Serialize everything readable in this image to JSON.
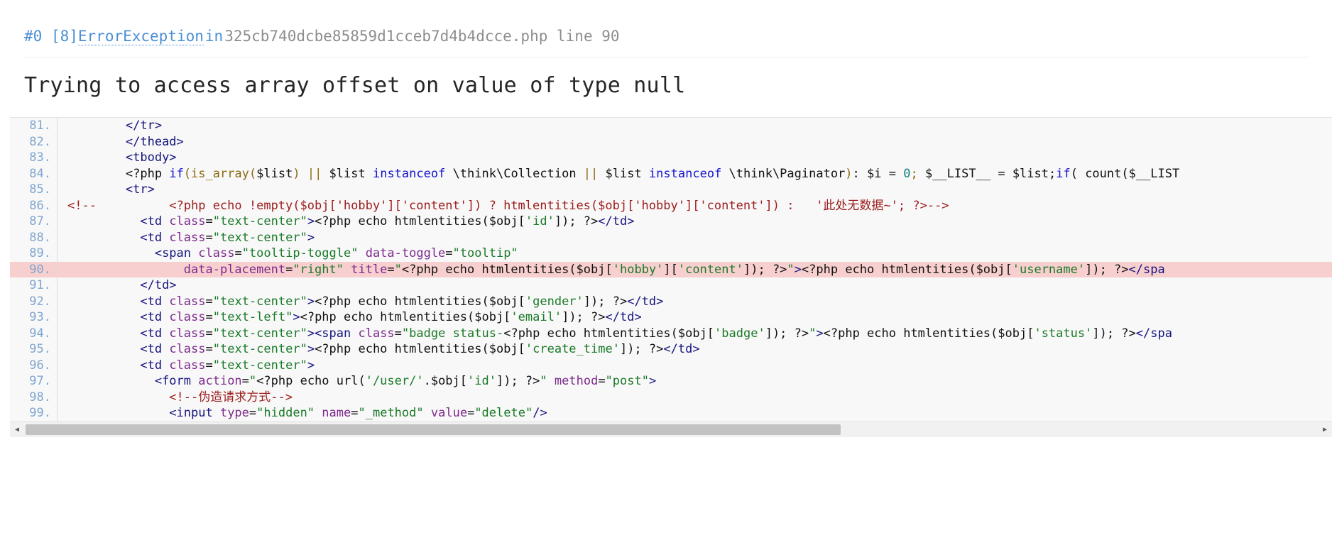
{
  "exception": {
    "frame_index": "#0",
    "type_bracket": "[8]",
    "class_name": "ErrorException",
    "in_word": "in",
    "file": "325cb740dcbe85859d1cceb7d4b4dcce.php",
    "line_word": "line",
    "line_number": "90",
    "message": "Trying to access array offset on value of type null"
  },
  "colors": {
    "link": "#4a8fd4",
    "file": "#8d8d8d",
    "highlight_row": "#f8cfcf",
    "code_bg": "#f8f8f8",
    "gutter_text": "#7ea6cf",
    "comment": "#9c1c1c",
    "tag": "#15147f",
    "attr": "#7d2a8c",
    "string": "#1a7a28",
    "keyword": "#1414cf"
  },
  "code": {
    "highlighted_line": 90,
    "lines": [
      {
        "n": "81.",
        "tokens": [
          {
            "t": "        ",
            "c": "t-plain"
          },
          {
            "t": "</tr>",
            "c": "t-tag"
          }
        ]
      },
      {
        "n": "82.",
        "tokens": [
          {
            "t": "        ",
            "c": "t-plain"
          },
          {
            "t": "</thead>",
            "c": "t-tag"
          }
        ]
      },
      {
        "n": "83.",
        "tokens": [
          {
            "t": "        ",
            "c": "t-plain"
          },
          {
            "t": "<tbody>",
            "c": "t-tag"
          }
        ]
      },
      {
        "n": "84.",
        "tokens": [
          {
            "t": "        ",
            "c": "t-plain"
          },
          {
            "t": "<?php ",
            "c": "t-php"
          },
          {
            "t": "if",
            "c": "t-kw"
          },
          {
            "t": "(is_array(",
            "c": "t-punc"
          },
          {
            "t": "$list",
            "c": "t-var"
          },
          {
            "t": ") ",
            "c": "t-punc"
          },
          {
            "t": "||",
            "c": "t-punc"
          },
          {
            "t": " $list ",
            "c": "t-var"
          },
          {
            "t": "instanceof",
            "c": "t-kw"
          },
          {
            "t": " \\think\\Collection ",
            "c": "t-plain"
          },
          {
            "t": "||",
            "c": "t-punc"
          },
          {
            "t": " $list ",
            "c": "t-var"
          },
          {
            "t": "instanceof",
            "c": "t-kw"
          },
          {
            "t": " \\think\\Paginator",
            "c": "t-plain"
          },
          {
            "t": ")",
            "c": "t-punc"
          },
          {
            "t": ": $i ",
            "c": "t-plain"
          },
          {
            "t": "=",
            "c": "t-plain"
          },
          {
            "t": " ",
            "c": "t-plain"
          },
          {
            "t": "0",
            "c": "t-num"
          },
          {
            "t": ";",
            "c": "t-punc"
          },
          {
            "t": " $__LIST__ ",
            "c": "t-plain"
          },
          {
            "t": "=",
            "c": "t-plain"
          },
          {
            "t": " $list;",
            "c": "t-plain"
          },
          {
            "t": "if",
            "c": "t-kw"
          },
          {
            "t": "( count($__LIST",
            "c": "t-plain"
          }
        ]
      },
      {
        "n": "85.",
        "tokens": [
          {
            "t": "        ",
            "c": "t-plain"
          },
          {
            "t": "<tr>",
            "c": "t-tag"
          }
        ]
      },
      {
        "n": "86.",
        "tokens": [
          {
            "t": "<!--          <?php echo !empty($obj['hobby']['content']) ? htmlentities($obj['hobby']['content']) :   '此处无数据~'; ?>-->",
            "c": "t-cmt"
          }
        ],
        "comment_full": true
      },
      {
        "n": "87.",
        "tokens": [
          {
            "t": "          ",
            "c": "t-plain"
          },
          {
            "t": "<td ",
            "c": "t-tag"
          },
          {
            "t": "class",
            "c": "t-attr"
          },
          {
            "t": "=",
            "c": "t-plain"
          },
          {
            "t": "\"text-center\"",
            "c": "t-str"
          },
          {
            "t": ">",
            "c": "t-tag"
          },
          {
            "t": "<?php echo htmlentities(",
            "c": "t-plain"
          },
          {
            "t": "$obj[",
            "c": "t-plain"
          },
          {
            "t": "'id'",
            "c": "t-str"
          },
          {
            "t": "]); ?>",
            "c": "t-plain"
          },
          {
            "t": "</td>",
            "c": "t-tag"
          }
        ]
      },
      {
        "n": "88.",
        "tokens": [
          {
            "t": "          ",
            "c": "t-plain"
          },
          {
            "t": "<td ",
            "c": "t-tag"
          },
          {
            "t": "class",
            "c": "t-attr"
          },
          {
            "t": "=",
            "c": "t-plain"
          },
          {
            "t": "\"text-center\"",
            "c": "t-str"
          },
          {
            "t": ">",
            "c": "t-tag"
          }
        ]
      },
      {
        "n": "89.",
        "tokens": [
          {
            "t": "            ",
            "c": "t-plain"
          },
          {
            "t": "<span ",
            "c": "t-tag"
          },
          {
            "t": "class",
            "c": "t-attr"
          },
          {
            "t": "=",
            "c": "t-plain"
          },
          {
            "t": "\"tooltip-toggle\"",
            "c": "t-str"
          },
          {
            "t": " ",
            "c": "t-plain"
          },
          {
            "t": "data-toggle",
            "c": "t-attr"
          },
          {
            "t": "=",
            "c": "t-plain"
          },
          {
            "t": "\"tooltip\"",
            "c": "t-str"
          }
        ]
      },
      {
        "n": "90.",
        "tokens": [
          {
            "t": "                ",
            "c": "t-plain"
          },
          {
            "t": "data-placement",
            "c": "t-attr"
          },
          {
            "t": "=",
            "c": "t-plain"
          },
          {
            "t": "\"right\"",
            "c": "t-str"
          },
          {
            "t": " ",
            "c": "t-plain"
          },
          {
            "t": "title",
            "c": "t-attr"
          },
          {
            "t": "=",
            "c": "t-plain"
          },
          {
            "t": "\"",
            "c": "t-str"
          },
          {
            "t": "<?php echo htmlentities(",
            "c": "t-plain"
          },
          {
            "t": "$obj[",
            "c": "t-plain"
          },
          {
            "t": "'hobby'",
            "c": "t-str"
          },
          {
            "t": "][",
            "c": "t-plain"
          },
          {
            "t": "'content'",
            "c": "t-str"
          },
          {
            "t": "]); ?>",
            "c": "t-plain"
          },
          {
            "t": "\"",
            "c": "t-str"
          },
          {
            "t": ">",
            "c": "t-tag"
          },
          {
            "t": "<?php echo htmlentities(",
            "c": "t-plain"
          },
          {
            "t": "$obj[",
            "c": "t-plain"
          },
          {
            "t": "'username'",
            "c": "t-str"
          },
          {
            "t": "]); ?>",
            "c": "t-plain"
          },
          {
            "t": "</spa",
            "c": "t-tag"
          }
        ]
      },
      {
        "n": "91.",
        "tokens": [
          {
            "t": "          ",
            "c": "t-plain"
          },
          {
            "t": "</td>",
            "c": "t-tag"
          }
        ]
      },
      {
        "n": "92.",
        "tokens": [
          {
            "t": "          ",
            "c": "t-plain"
          },
          {
            "t": "<td ",
            "c": "t-tag"
          },
          {
            "t": "class",
            "c": "t-attr"
          },
          {
            "t": "=",
            "c": "t-plain"
          },
          {
            "t": "\"text-center\"",
            "c": "t-str"
          },
          {
            "t": ">",
            "c": "t-tag"
          },
          {
            "t": "<?php echo htmlentities(",
            "c": "t-plain"
          },
          {
            "t": "$obj[",
            "c": "t-plain"
          },
          {
            "t": "'gender'",
            "c": "t-str"
          },
          {
            "t": "]); ?>",
            "c": "t-plain"
          },
          {
            "t": "</td>",
            "c": "t-tag"
          }
        ]
      },
      {
        "n": "93.",
        "tokens": [
          {
            "t": "          ",
            "c": "t-plain"
          },
          {
            "t": "<td ",
            "c": "t-tag"
          },
          {
            "t": "class",
            "c": "t-attr"
          },
          {
            "t": "=",
            "c": "t-plain"
          },
          {
            "t": "\"text-left\"",
            "c": "t-str"
          },
          {
            "t": ">",
            "c": "t-tag"
          },
          {
            "t": "<?php echo htmlentities(",
            "c": "t-plain"
          },
          {
            "t": "$obj[",
            "c": "t-plain"
          },
          {
            "t": "'email'",
            "c": "t-str"
          },
          {
            "t": "]); ?>",
            "c": "t-plain"
          },
          {
            "t": "</td>",
            "c": "t-tag"
          }
        ]
      },
      {
        "n": "94.",
        "tokens": [
          {
            "t": "          ",
            "c": "t-plain"
          },
          {
            "t": "<td ",
            "c": "t-tag"
          },
          {
            "t": "class",
            "c": "t-attr"
          },
          {
            "t": "=",
            "c": "t-plain"
          },
          {
            "t": "\"text-center\"",
            "c": "t-str"
          },
          {
            "t": ">",
            "c": "t-tag"
          },
          {
            "t": "<span ",
            "c": "t-tag"
          },
          {
            "t": "class",
            "c": "t-attr"
          },
          {
            "t": "=",
            "c": "t-plain"
          },
          {
            "t": "\"badge status-",
            "c": "t-str"
          },
          {
            "t": "<?php echo htmlentities(",
            "c": "t-plain"
          },
          {
            "t": "$obj[",
            "c": "t-plain"
          },
          {
            "t": "'badge'",
            "c": "t-str"
          },
          {
            "t": "]); ?>",
            "c": "t-plain"
          },
          {
            "t": "\"",
            "c": "t-str"
          },
          {
            "t": ">",
            "c": "t-tag"
          },
          {
            "t": "<?php echo htmlentities(",
            "c": "t-plain"
          },
          {
            "t": "$obj[",
            "c": "t-plain"
          },
          {
            "t": "'status'",
            "c": "t-str"
          },
          {
            "t": "]); ?>",
            "c": "t-plain"
          },
          {
            "t": "</spa",
            "c": "t-tag"
          }
        ]
      },
      {
        "n": "95.",
        "tokens": [
          {
            "t": "          ",
            "c": "t-plain"
          },
          {
            "t": "<td ",
            "c": "t-tag"
          },
          {
            "t": "class",
            "c": "t-attr"
          },
          {
            "t": "=",
            "c": "t-plain"
          },
          {
            "t": "\"text-center\"",
            "c": "t-str"
          },
          {
            "t": ">",
            "c": "t-tag"
          },
          {
            "t": "<?php echo htmlentities(",
            "c": "t-plain"
          },
          {
            "t": "$obj[",
            "c": "t-plain"
          },
          {
            "t": "'create_time'",
            "c": "t-str"
          },
          {
            "t": "]); ?>",
            "c": "t-plain"
          },
          {
            "t": "</td>",
            "c": "t-tag"
          }
        ]
      },
      {
        "n": "96.",
        "tokens": [
          {
            "t": "          ",
            "c": "t-plain"
          },
          {
            "t": "<td ",
            "c": "t-tag"
          },
          {
            "t": "class",
            "c": "t-attr"
          },
          {
            "t": "=",
            "c": "t-plain"
          },
          {
            "t": "\"text-center\"",
            "c": "t-str"
          },
          {
            "t": ">",
            "c": "t-tag"
          }
        ]
      },
      {
        "n": "97.",
        "tokens": [
          {
            "t": "            ",
            "c": "t-plain"
          },
          {
            "t": "<form ",
            "c": "t-tag"
          },
          {
            "t": "action",
            "c": "t-attr"
          },
          {
            "t": "=",
            "c": "t-plain"
          },
          {
            "t": "\"",
            "c": "t-str"
          },
          {
            "t": "<?php echo url(",
            "c": "t-plain"
          },
          {
            "t": "'/user/'",
            "c": "t-str"
          },
          {
            "t": ".$obj[",
            "c": "t-plain"
          },
          {
            "t": "'id'",
            "c": "t-str"
          },
          {
            "t": "]); ?>",
            "c": "t-plain"
          },
          {
            "t": "\"",
            "c": "t-str"
          },
          {
            "t": " ",
            "c": "t-plain"
          },
          {
            "t": "method",
            "c": "t-attr"
          },
          {
            "t": "=",
            "c": "t-plain"
          },
          {
            "t": "\"post\"",
            "c": "t-str"
          },
          {
            "t": ">",
            "c": "t-tag"
          }
        ]
      },
      {
        "n": "98.",
        "tokens": [
          {
            "t": "              ",
            "c": "t-plain"
          },
          {
            "t": "<!--伪造请求方式-->",
            "c": "t-cmt"
          }
        ]
      },
      {
        "n": "99.",
        "tokens": [
          {
            "t": "              ",
            "c": "t-plain"
          },
          {
            "t": "<input ",
            "c": "t-tag"
          },
          {
            "t": "type",
            "c": "t-attr"
          },
          {
            "t": "=",
            "c": "t-plain"
          },
          {
            "t": "\"hidden\"",
            "c": "t-str"
          },
          {
            "t": " ",
            "c": "t-plain"
          },
          {
            "t": "name",
            "c": "t-attr"
          },
          {
            "t": "=",
            "c": "t-plain"
          },
          {
            "t": "\"_method\"",
            "c": "t-str"
          },
          {
            "t": " ",
            "c": "t-plain"
          },
          {
            "t": "value",
            "c": "t-attr"
          },
          {
            "t": "=",
            "c": "t-plain"
          },
          {
            "t": "\"delete\"",
            "c": "t-str"
          },
          {
            "t": "/>",
            "c": "t-tag"
          }
        ]
      }
    ]
  },
  "scrollbar": {
    "left_arrow": "◀",
    "right_arrow": "▶",
    "thumb_width_pct": "63%"
  }
}
